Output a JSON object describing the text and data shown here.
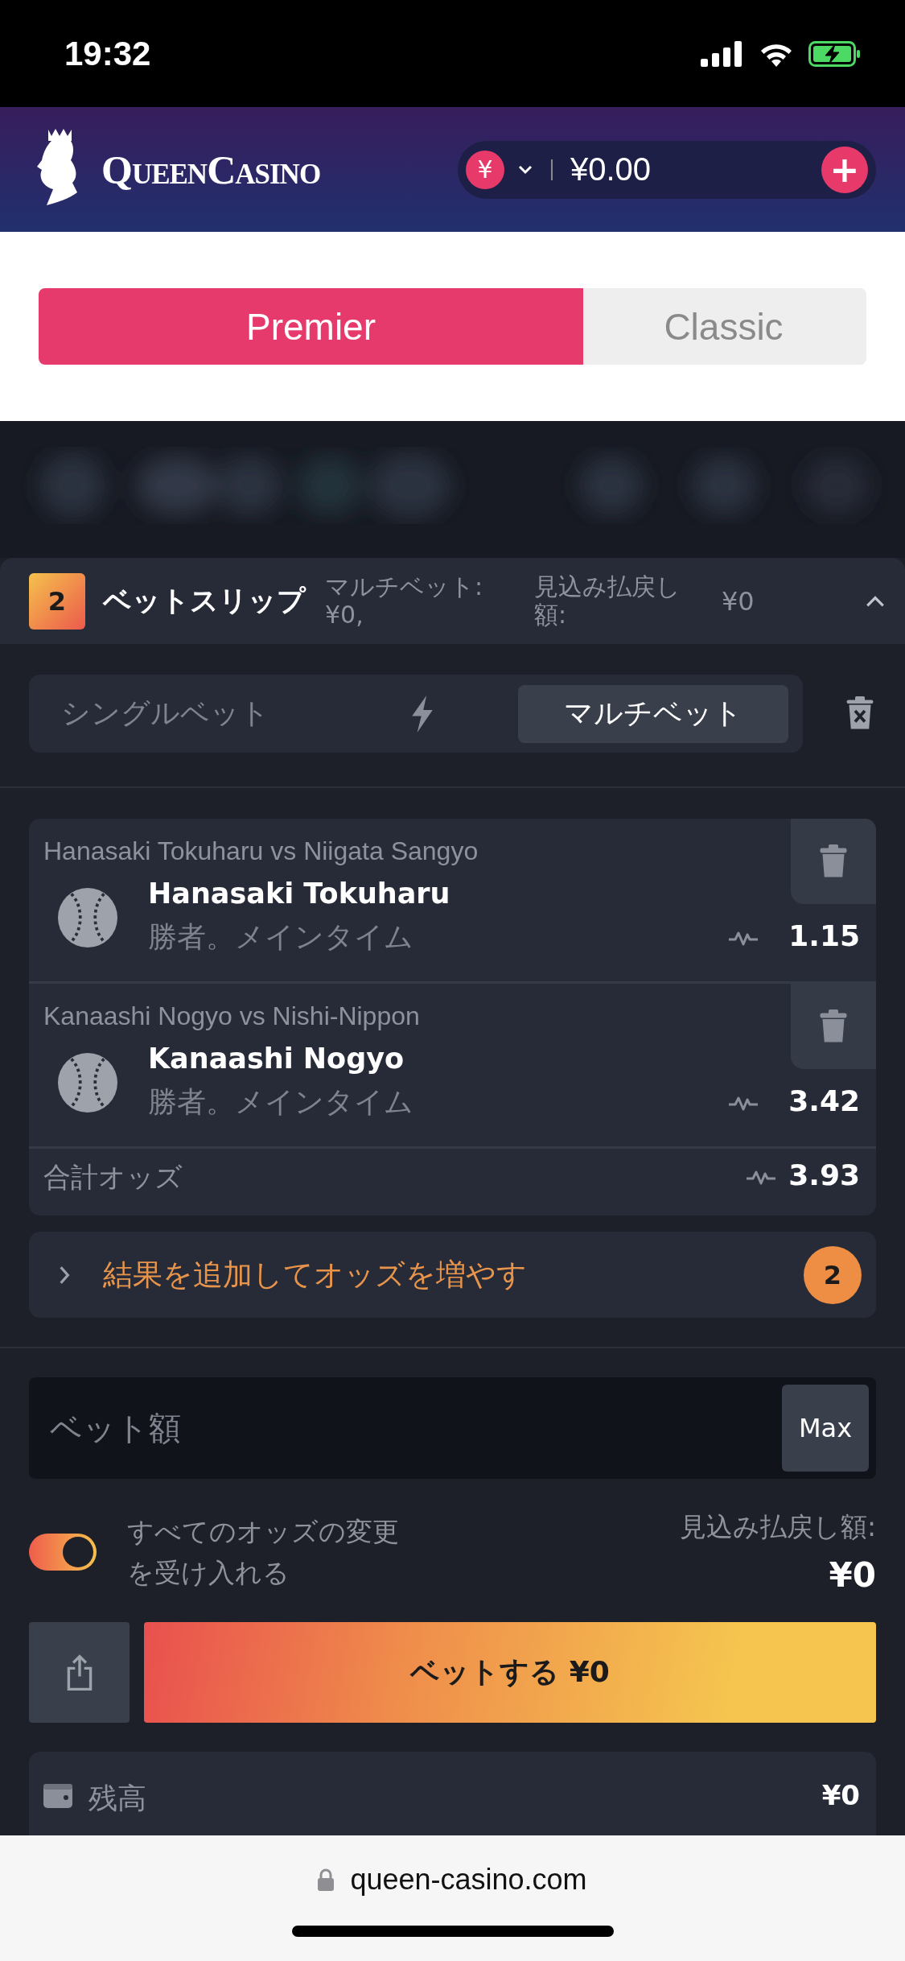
{
  "status_bar": {
    "time": "19:32"
  },
  "header": {
    "logo": "QueenCasino",
    "currency": "¥",
    "balance": "¥0.00",
    "add": "+"
  },
  "tabs": [
    {
      "label": "Premier",
      "selected": true
    },
    {
      "label": "Classic",
      "selected": false
    }
  ],
  "betslip": {
    "count": "2",
    "title": "ベットスリップ",
    "multi_summary": "マルチベット: ¥0,",
    "payout_label": "見込み払戻し額:",
    "payout": "¥0",
    "expanded": true
  },
  "bet_modes": [
    {
      "label": "シングルベット",
      "selected": false
    },
    {
      "label": "マルチベット",
      "selected": true
    }
  ],
  "selections": [
    {
      "match": "Hanasaki Tokuharu vs Niigata Sangyo",
      "team": "Hanasaki Tokuharu",
      "market": "勝者。メインタイム",
      "odds": "1.15"
    },
    {
      "match": "Kanaashi Nogyo vs Nishi-Nippon",
      "team": "Kanaashi Nogyo",
      "market": "勝者。メインタイム",
      "odds": "3.42"
    }
  ],
  "total": {
    "label": "合計オッズ",
    "odds": "3.93"
  },
  "boost": {
    "label": "結果を追加してオッズを増やす",
    "count": "2"
  },
  "stake": {
    "placeholder": "ベット額",
    "max": "Max"
  },
  "accept_odds": {
    "label": "すべてのオッズの変更を受け入れる",
    "on": true
  },
  "potential": {
    "label": "見込み払戻し額:",
    "value": "¥0"
  },
  "place_bet": "ベットする ¥0",
  "balance": {
    "label": "残高",
    "value": "¥0"
  },
  "browser": {
    "url": "queen-casino.com"
  }
}
